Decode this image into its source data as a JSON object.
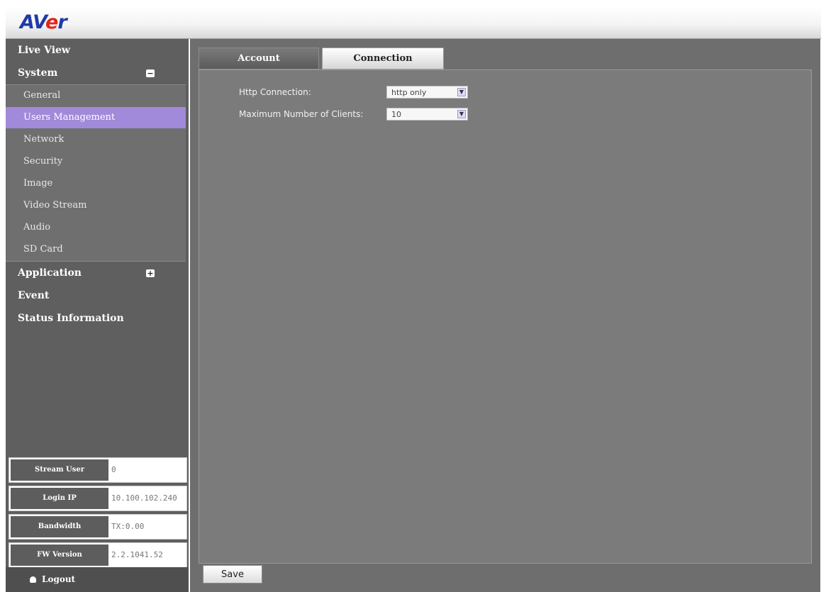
{
  "header": {
    "logo_prefix": "AV",
    "logo_e": "e",
    "logo_suffix": "r"
  },
  "sidebar": {
    "live_view": "Live View",
    "system": "System",
    "system_toggle": "−",
    "system_items": [
      "General",
      "Users Management",
      "Network",
      "Security",
      "Image",
      "Video Stream",
      "Audio",
      "SD Card"
    ],
    "active_item": "Users Management",
    "application": "Application",
    "application_toggle": "+",
    "event": "Event",
    "status_information": "Status Information"
  },
  "info": [
    {
      "label": "Stream User",
      "value": "0"
    },
    {
      "label": "Login IP",
      "value": "10.100.102.240"
    },
    {
      "label": "Bandwidth",
      "value": "TX:0.00"
    },
    {
      "label": "FW Version",
      "value": "2.2.1041.52"
    }
  ],
  "logout": "Logout",
  "tabs": {
    "account": "Account",
    "connection": "Connection"
  },
  "form": {
    "http_connection_label": "Http Connection:",
    "http_connection_value": "http only",
    "max_clients_label": "Maximum Number of Clients:",
    "max_clients_value": "10"
  },
  "save_label": "Save"
}
